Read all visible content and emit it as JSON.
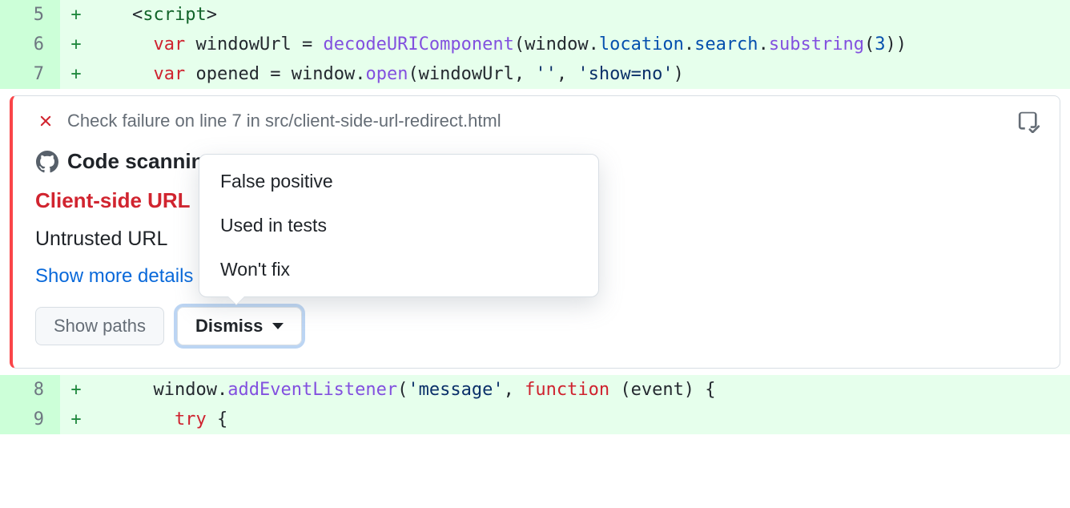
{
  "code": {
    "lines": [
      {
        "num": "5",
        "sign": "+"
      },
      {
        "num": "6",
        "sign": "+"
      },
      {
        "num": "7",
        "sign": "+"
      },
      {
        "num": "8",
        "sign": "+"
      },
      {
        "num": "9",
        "sign": "+"
      }
    ],
    "l5": {
      "open": "<",
      "tag": "script",
      "close": ">"
    },
    "l6": {
      "kw": "var",
      "name": " windowUrl ",
      "eq": "= ",
      "fn": "decodeURIComponent",
      "popen": "(",
      "obj1": "window",
      "dot1": ".",
      "prop1": "location",
      "dot2": ".",
      "prop2": "search",
      "dot3": ".",
      "fn2": "substring",
      "args": "(",
      "num": "3",
      "pclose": "))"
    },
    "l7": {
      "kw": "var",
      "name": " opened ",
      "eq": "= ",
      "obj": "window",
      "dot": ".",
      "fn": "open",
      "popen": "(windowUrl, ",
      "s1": "''",
      "comma": ", ",
      "s2": "'show=no'",
      "pclose": ")"
    },
    "l8": {
      "obj": "window",
      "dot": ".",
      "fn": "addEventListener",
      "popen": "(",
      "s1": "'message'",
      "comma": ", ",
      "kw": "function",
      "args": " (event) {"
    },
    "l9": {
      "kw": "try",
      "brace": " {"
    }
  },
  "annotation": {
    "header": "Check failure on line 7 in src/client-side-url-redirect.html",
    "scanning_label": "Code scanning",
    "alert_title": "Client-side URL",
    "alert_desc": "Untrusted URL",
    "show_more": "Show more details",
    "show_paths": "Show paths",
    "dismiss": "Dismiss",
    "dropdown": {
      "opt1": "False positive",
      "opt2": "Used in tests",
      "opt3": "Won't fix"
    }
  }
}
